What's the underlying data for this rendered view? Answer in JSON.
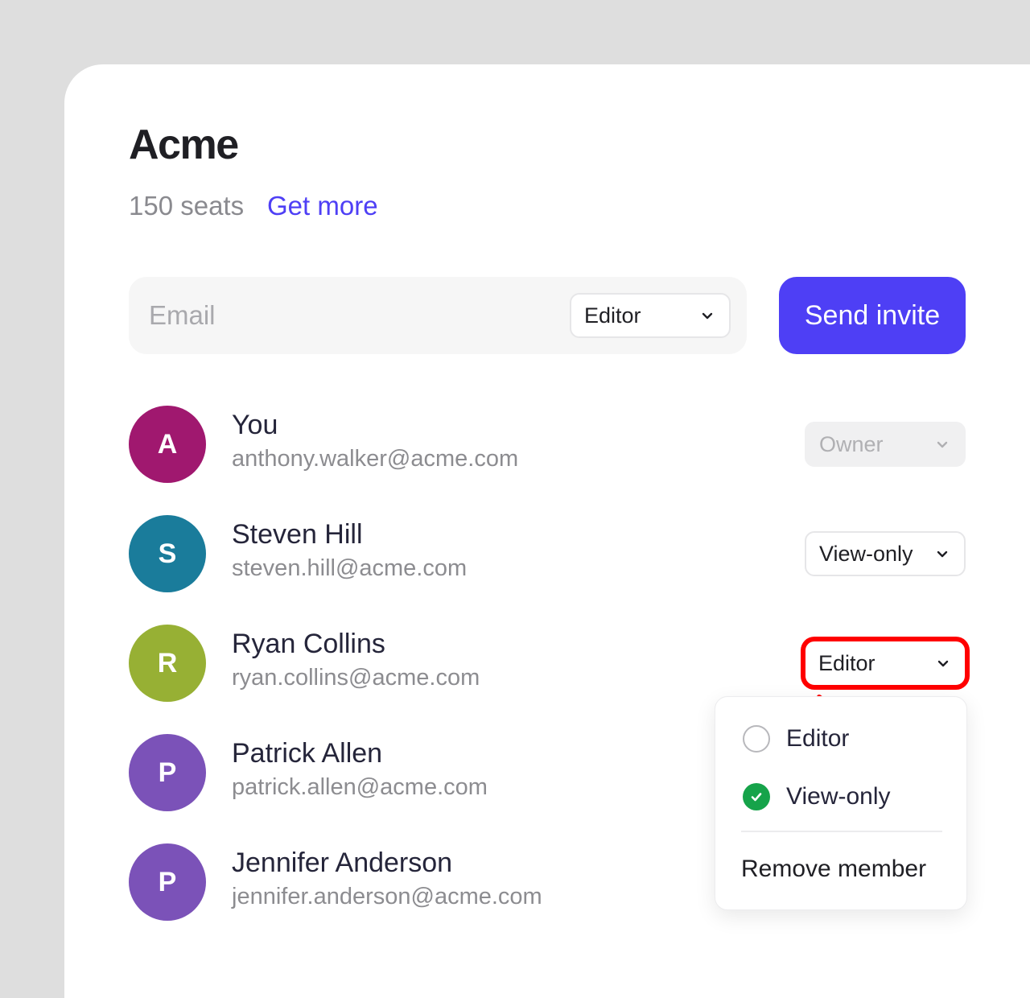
{
  "org": {
    "name": "Acme",
    "seats": "150 seats",
    "get_more": "Get more"
  },
  "invite": {
    "email_placeholder": "Email",
    "role": "Editor",
    "send_label": "Send invite"
  },
  "members": [
    {
      "initial": "A",
      "name": "You",
      "email": "anthony.walker@acme.com",
      "role": "Owner",
      "avatar_color": "#a0186f"
    },
    {
      "initial": "S",
      "name": "Steven Hill",
      "email": "steven.hill@acme.com",
      "role": "View-only",
      "avatar_color": "#1a7c9b"
    },
    {
      "initial": "R",
      "name": "Ryan Collins",
      "email": "ryan.collins@acme.com",
      "role": "Editor",
      "avatar_color": "#97b034"
    },
    {
      "initial": "P",
      "name": "Patrick Allen",
      "email": "patrick.allen@acme.com",
      "avatar_color": "#7b52b8"
    },
    {
      "initial": "P",
      "name": "Jennifer Anderson",
      "email": "jennifer.anderson@acme.com",
      "avatar_color": "#7b52b8"
    }
  ],
  "role_menu": {
    "options": [
      {
        "label": "Editor",
        "selected": false
      },
      {
        "label": "View-only",
        "selected": true
      }
    ],
    "remove_label": "Remove member"
  },
  "colors": {
    "accent": "#4e3ff5",
    "highlight": "#ff0000",
    "success": "#16a34a"
  }
}
